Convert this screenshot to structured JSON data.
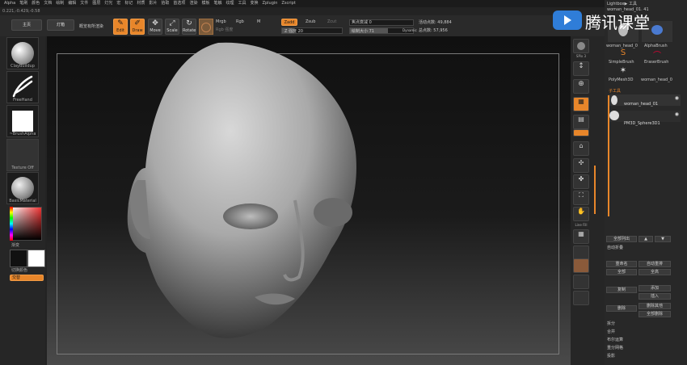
{
  "menu": [
    "Alpha",
    "笔刷",
    "颜色",
    "文档",
    "绘制",
    "编辑",
    "文件",
    "图层",
    "灯光",
    "宏",
    "标记",
    "材质",
    "影片",
    "拾取",
    "首选项",
    "渲染",
    "模板",
    "笔触",
    "纹理",
    "工具",
    "变换",
    "Zplugin",
    "Zscript"
  ],
  "coords": "0.221,-0.429,-0.58",
  "top": {
    "home_label": "主页",
    "light_label": "灯箱",
    "projection_label": "概览有所渲染",
    "edit_label": "Edit",
    "draw_label": "Draw",
    "move_label": "Move",
    "scale_label": "Scale",
    "rotate_label": "Rotate",
    "mrgb": "Mrgb",
    "rgb": "Rgb",
    "m": "M",
    "rgb_intensity": "Rgb 强度",
    "zadd": "Zadd",
    "zsub": "Zsub",
    "zcut": "Zcut",
    "z_intensity": "Z 强度 20",
    "focal": "焦点衰减 0",
    "draw_size": "绘制大小 71",
    "dynamic": "Dynamic",
    "active_points": "活动点数: 49,884",
    "total_points": "总点数: 57,956"
  },
  "left": {
    "brush": "ClayBuildup",
    "stroke": "FreeHand",
    "alpha": "~BrushAlpha",
    "texture": "Texture Off",
    "material": "BasicMaterial",
    "gradient": "渐变",
    "switch_color": "切换颜色",
    "alternate": "交替",
    "colors": {
      "accent": "#e8862a",
      "fg": "#111111",
      "bg": "#ffffff"
    }
  },
  "right_tools": {
    "bpr": "BPR",
    "spix": "SPix 3",
    "scroll": "滚动",
    "zoom": "缩放",
    "actual": "实际",
    "aahalf": "AAHalf",
    "persp": "透视",
    "floor": "地面",
    "local": "局部",
    "xyz": "XYZ",
    "frame": "框架",
    "move": "移动",
    "zoom3d": "缩放",
    "rotate": "旋转",
    "line_fill": "Line Fill",
    "polyf": "PolyF",
    "transp": "透明",
    "ghost": "幽灵",
    "solo": "单独",
    "xpose": "Xpose"
  },
  "lightbox": {
    "title": "Lightbox▶ 工具",
    "current": "woman_head_01. 41",
    "tools": [
      "woman_head_0",
      "AlphaBrush",
      "SimpleBrush",
      "EraserBrush",
      "PolyMesh3D",
      "woman_head_0"
    ]
  },
  "subtool": {
    "title": "子工具",
    "items": [
      "woman_head_01",
      "PM3D_Sphere3D1"
    ],
    "buttons": [
      "全部列出",
      "自动折叠",
      "重命名",
      "自动重排",
      "全部",
      "全高",
      "复制",
      "添加",
      "插入",
      "删除",
      "删除其他",
      "全部删除",
      "拆分",
      "合并",
      "布尔运算",
      "重分网格",
      "投影"
    ]
  },
  "brand": "腾讯课堂"
}
